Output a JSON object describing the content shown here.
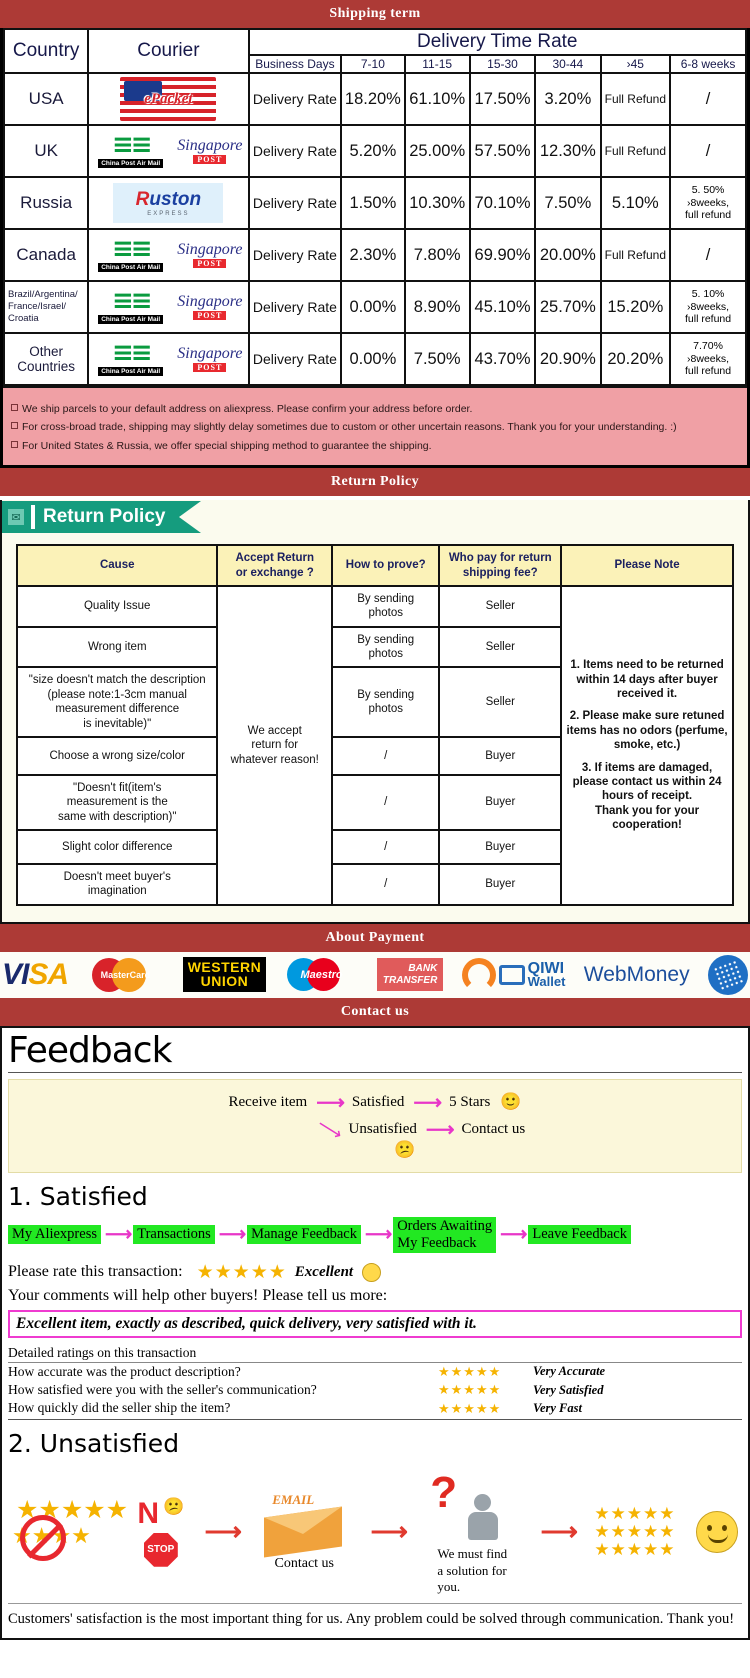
{
  "banners": {
    "shipping": "Shipping term",
    "return": "Return Policy",
    "payment": "About Payment",
    "contact": "Contact us"
  },
  "shipping_table": {
    "headers": {
      "country": "Country",
      "courier": "Courier",
      "delivery_time_rate": "Delivery Time Rate",
      "business_days": "Business Days",
      "ranges": [
        "7-10",
        "11-15",
        "15-30",
        "30-44",
        "›45",
        "6-8 weeks"
      ]
    },
    "rows": [
      {
        "country": "USA",
        "couriers": [
          "epacket"
        ],
        "label": "Delivery Rate",
        "values": [
          "18.20%",
          "61.10%",
          "17.50%",
          "3.20%",
          "Full Refund",
          "/"
        ]
      },
      {
        "country": "UK",
        "couriers": [
          "china-post-air-mail",
          "singapore-post"
        ],
        "label": "Delivery Rate",
        "values": [
          "5.20%",
          "25.00%",
          "57.50%",
          "12.30%",
          "Full Refund",
          "/"
        ]
      },
      {
        "country": "Russia",
        "couriers": [
          "ruston-express"
        ],
        "label": "Delivery Rate",
        "values": [
          "1.50%",
          "10.30%",
          "70.10%",
          "7.50%",
          "5.10%",
          "5. 50%\n›8weeks,\nfull refund"
        ]
      },
      {
        "country": "Canada",
        "couriers": [
          "china-post-air-mail",
          "singapore-post"
        ],
        "label": "Delivery Rate",
        "values": [
          "2.30%",
          "7.80%",
          "69.90%",
          "20.00%",
          "Full Refund",
          "/"
        ]
      },
      {
        "country": "Brazil/Argentina/\nFrance/Israel/\nCroatia",
        "couriers": [
          "china-post-air-mail",
          "singapore-post"
        ],
        "label": "Delivery Rate",
        "values": [
          "0.00%",
          "8.90%",
          "45.10%",
          "25.70%",
          "15.20%",
          "5. 10%\n›8weeks,\nfull refund"
        ]
      },
      {
        "country": "Other Countries",
        "couriers": [
          "china-post-air-mail",
          "singapore-post"
        ],
        "label": "Delivery Rate",
        "values": [
          "0.00%",
          "7.50%",
          "43.70%",
          "20.90%",
          "20.20%",
          "7.70%\n›8weeks,\nfull refund"
        ]
      }
    ],
    "notes": [
      "We ship parcels to your default address on aliexpress. Please confirm your address before order.",
      "For cross-broad trade, shipping may slightly delay sometimes due to custom or other uncertain reasons. Thank you for your understanding. :)",
      "For United States & Russia, we offer special shipping method to guarantee the shipping."
    ]
  },
  "return_policy": {
    "tab_label": "Return Policy",
    "headers": [
      "Cause",
      "Accept Return\nor exchange ?",
      "How to prove?",
      "Who pay for return\nshipping fee?",
      "Please Note"
    ],
    "accept_text": "We accept\nreturn for\nwhatever reason!",
    "rows": [
      {
        "cause": "Quality Issue",
        "prove": "By sending\nphotos",
        "payer": "Seller"
      },
      {
        "cause": "Wrong item",
        "prove": "By sending\nphotos",
        "payer": "Seller"
      },
      {
        "cause": "\"size doesn't match the description\n(please note:1-3cm manual\nmeasurement difference\nis inevitable)\"",
        "prove": "By sending\nphotos",
        "payer": "Seller"
      },
      {
        "cause": "Choose a wrong size/color",
        "prove": "/",
        "payer": "Buyer"
      },
      {
        "cause": "\"Doesn't fit(item's\nmeasurement is the\nsame with description)\"",
        "prove": "/",
        "payer": "Buyer"
      },
      {
        "cause": "Slight color difference",
        "prove": "/",
        "payer": "Buyer"
      },
      {
        "cause": "Doesn't meet buyer's\nimagination",
        "prove": "/",
        "payer": "Buyer"
      }
    ],
    "notes": [
      "1. Items need to be returned within 14 days after buyer received it.",
      "2. Please make sure retuned items has no odors (perfume, smoke, etc.)",
      "3. If items are damaged, please contact us within 24 hours of receipt.",
      "Thank you for your cooperation!"
    ]
  },
  "payment_methods": [
    {
      "name": "visa",
      "label": "VISA"
    },
    {
      "name": "mastercard",
      "label": "MasterCard"
    },
    {
      "name": "western-union",
      "label_1": "WESTERN",
      "label_2": "UNION"
    },
    {
      "name": "maestro",
      "label": "Maestro"
    },
    {
      "name": "bank-transfer",
      "label_1": "BANK",
      "label_2": "TRANSFER"
    },
    {
      "name": "qiwi-wallet",
      "label_1": "QIWI",
      "label_2": "Wallet"
    },
    {
      "name": "webmoney",
      "label": "WebMoney"
    },
    {
      "name": "webmoney-globe",
      "label": ""
    }
  ],
  "feedback": {
    "title": "Feedback",
    "flow": {
      "receive": "Receive item",
      "satisfied": "Satisfied",
      "five_stars": "5 Stars",
      "unsatisfied": "Unsatisfied",
      "contact_us": "Contact us"
    },
    "satisfied": {
      "heading": "1. Satisfied",
      "steps": [
        "My Aliexpress",
        "Transactions",
        "Manage Feedback",
        "Orders Awaiting\nMy Feedback",
        "Leave Feedback"
      ],
      "rate_prompt": "Please rate this transaction:",
      "stars": "★★★★★",
      "rating_word": "Excellent",
      "comment_prompt": "Your comments will help other buyers! Please tell us more:",
      "comment_example": "Excellent item, exactly as described, quick delivery, very satisfied with it.",
      "detail_title": "Detailed ratings on this transaction",
      "details": [
        {
          "question": "How accurate was the product description?",
          "stars": "★★★★★",
          "verdict": "Very Accurate"
        },
        {
          "question": "How satisfied were you with the seller's communication?",
          "stars": "★★★★★",
          "verdict": "Very Satisfied"
        },
        {
          "question": "How quickly did the seller ship the item?",
          "stars": "★★★★★",
          "verdict": "Very Fast"
        }
      ]
    },
    "unsatisfied": {
      "heading": "2. Unsatisfied",
      "no_label": "N",
      "stop_label": "STOP",
      "email_label": "EMAIL",
      "contact_label": "Contact us",
      "solution_label": "We must find\na solution for\nyou.",
      "stars_block": "★★★★★\n★★★★★\n★★★★★",
      "closing": "Customers' satisfaction is the most important thing for us. Any problem could be solved through communication. Thank you!"
    }
  }
}
